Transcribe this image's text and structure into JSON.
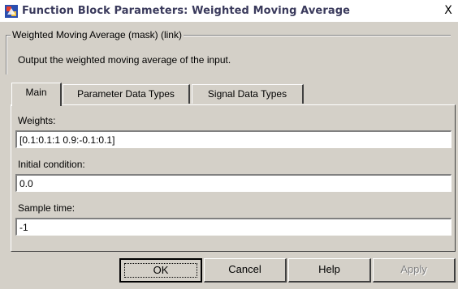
{
  "window": {
    "title": "Function Block Parameters: Weighted Moving Average",
    "close_symbol": "X",
    "icon": "simulink-block-icon"
  },
  "group": {
    "legend": "Weighted Moving Average (mask) (link)",
    "description": "Output the weighted moving average of the input."
  },
  "tabs": [
    {
      "label": "Main",
      "active": true
    },
    {
      "label": "Parameter Data Types",
      "active": false
    },
    {
      "label": "Signal Data Types",
      "active": false
    }
  ],
  "fields": {
    "weights": {
      "label": "Weights:",
      "value": "[0.1:0.1:1 0.9:-0.1:0.1]"
    },
    "initial_condition": {
      "label": "Initial condition:",
      "value": "0.0"
    },
    "sample_time": {
      "label": "Sample time:",
      "value": "-1"
    }
  },
  "buttons": {
    "ok": "OK",
    "cancel": "Cancel",
    "help": "Help",
    "apply": "Apply"
  }
}
